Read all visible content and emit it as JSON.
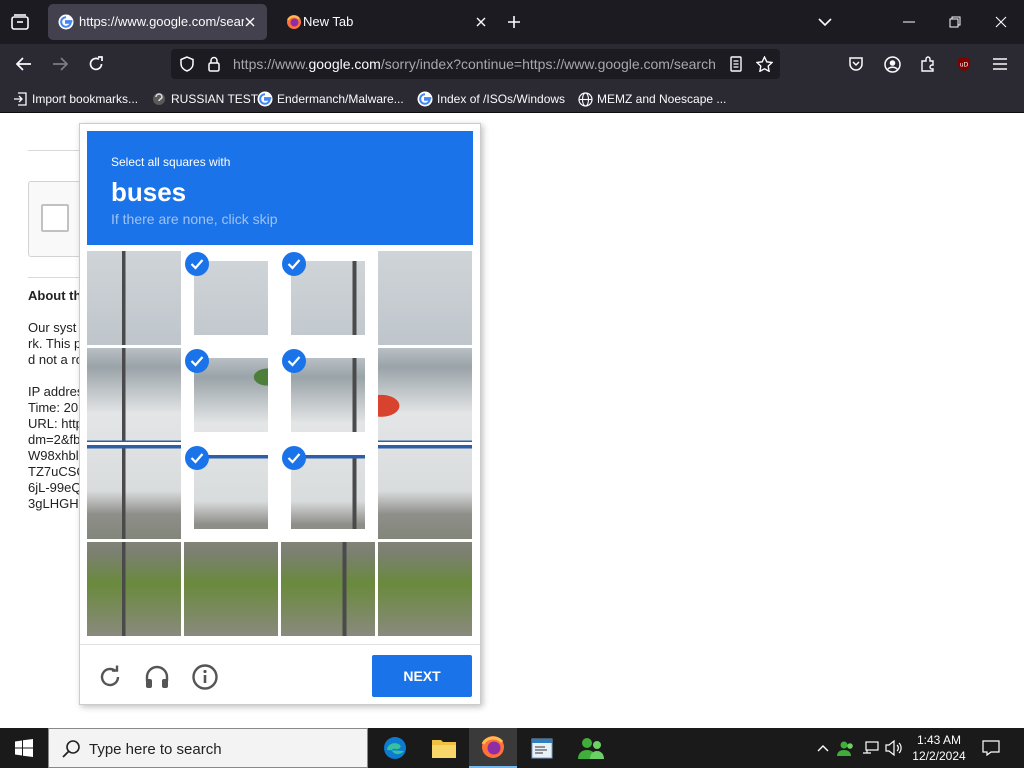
{
  "browser": {
    "tabs": [
      {
        "title": "https://www.google.com/search?q=",
        "active": true,
        "icon": "google-g-icon"
      },
      {
        "title": "New Tab",
        "active": false,
        "icon": "firefox-icon"
      }
    ],
    "url_prefix": "https://www.",
    "url_domain": "google.com",
    "url_rest": "/sorry/index?continue=https://www.google.com/search",
    "bookmarks": [
      {
        "label": "Import bookmarks...",
        "icon": "import-icon"
      },
      {
        "label": "RUSSIAN TEST",
        "icon": "site-icon"
      },
      {
        "label": "Endermanch/Malware...",
        "icon": "google-g-icon"
      },
      {
        "label": "Index of /ISOs/Windows",
        "icon": "google-g-icon"
      },
      {
        "label": "MEMZ and Noescape ...",
        "icon": "globe-icon"
      }
    ]
  },
  "page": {
    "about_heading": "About th",
    "lines": [
      "Our syst",
      "rk. This p",
      "d not a ro",
      "",
      "IP addres",
      "Time: 20",
      "URL: http",
      "dm=2&fb",
      "W98xhbl",
      "TZ7uCSC",
      "6jL-99eQ",
      "3gLHGH"
    ]
  },
  "captcha": {
    "instruction": "Select all squares with",
    "target": "buses",
    "hint": "If there are none, click skip",
    "next_label": "NEXT",
    "tiles": [
      {
        "selected": false
      },
      {
        "selected": true
      },
      {
        "selected": true
      },
      {
        "selected": false
      },
      {
        "selected": false
      },
      {
        "selected": true
      },
      {
        "selected": true
      },
      {
        "selected": false
      },
      {
        "selected": false
      },
      {
        "selected": true
      },
      {
        "selected": true
      },
      {
        "selected": false
      },
      {
        "selected": false
      },
      {
        "selected": false
      },
      {
        "selected": false
      },
      {
        "selected": false
      }
    ]
  },
  "taskbar": {
    "search_placeholder": "Type here to search",
    "time": "1:43 AM",
    "date": "12/2/2024",
    "apps": [
      "edge-icon",
      "file-explorer-icon",
      "firefox-icon",
      "notepad-icon",
      "people-icon"
    ]
  },
  "colors": {
    "accent": "#1a73e8",
    "tabbar": "#1c1b22",
    "toolbar": "#2b2a33"
  }
}
